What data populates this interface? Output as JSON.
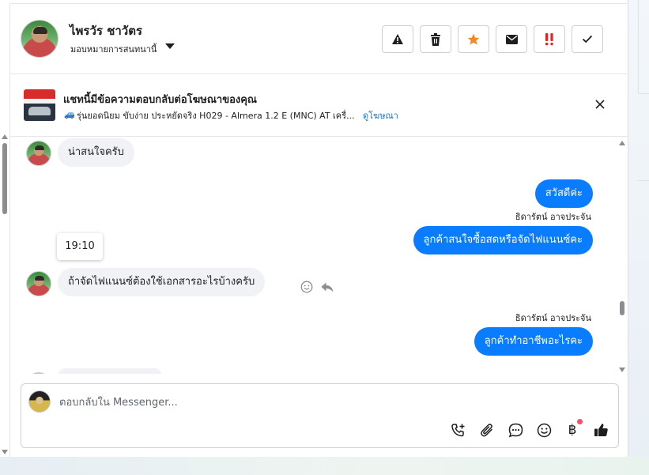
{
  "header": {
    "contact_name": "ไพรวัร ชาวัตร",
    "assign_label": "มอบหมายการสนทนานี้",
    "actions": [
      {
        "name": "spam-button",
        "icon": "warning-icon"
      },
      {
        "name": "delete-button",
        "icon": "trash-icon"
      },
      {
        "name": "star-button",
        "icon": "star-icon",
        "color": "#f08a24"
      },
      {
        "name": "email-button",
        "icon": "envelope-icon"
      },
      {
        "name": "urgent-button",
        "icon": "double-exclamation-icon",
        "color": "#e02424"
      },
      {
        "name": "done-button",
        "icon": "check-icon"
      }
    ]
  },
  "ad": {
    "title": "แชทนี้มีข้อความตอบกลับต่อโฆษณาของคุณ",
    "subtitle": "รุ่นยอดนิยม ขับง่าย ประหยัดจริง H029 - Almera 1.2 E (MNC) AT เครื่...",
    "view_ad_link": "ดูโฆษณา"
  },
  "messages": [
    {
      "direction": "in",
      "text": "น่าสนใจครับ"
    },
    {
      "direction": "out",
      "text": "สวัสดีค่ะ"
    },
    {
      "direction": "out",
      "sender": "ธิดารัตน์ อาจประจัน",
      "text": "ลูกค้าสนใจซื้อสดหรือจัดไฟแนนซ์คะ"
    },
    {
      "direction": "in",
      "text": "ถ้าจัดไฟแนนซ์ต้องใช้เอกสารอะไรบ้างครับ"
    },
    {
      "direction": "out",
      "sender": "ธิดารัตน์ อาจประจัน",
      "text": "ลูกค้าทำอาชีพอะไรคะ"
    }
  ],
  "timestamp_tooltip": "19:10",
  "composer": {
    "placeholder": "ตอบกลับใน Messenger...",
    "tools": [
      "phone-add-icon",
      "paperclip-icon",
      "chat-bubble-icon",
      "emoji-icon",
      "baht-icon",
      "thumbs-up-icon"
    ]
  },
  "colors": {
    "outgoing_bubble": "#0a7cff",
    "incoming_bubble": "#f0f2f5",
    "link": "#1a73c8",
    "notification_dot": "#f25268"
  }
}
